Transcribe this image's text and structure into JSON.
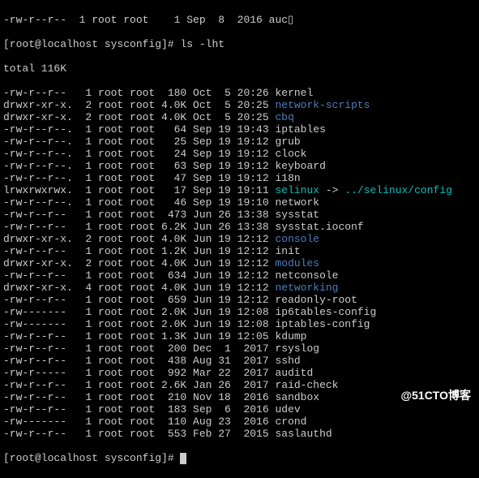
{
  "top_fragment": "-rw-r--r--  1 root root    1 Sep  8  2016 auc▯",
  "prompt": "[root@localhost sysconfig]# ",
  "command": "ls -lht",
  "total_line": "total 116K",
  "files": [
    {
      "perm": "-rw-r--r--",
      "links": "1",
      "owner": "root",
      "group": "root",
      "size": "180",
      "date": "Oct  5 20:26",
      "name": "kernel",
      "type": "file"
    },
    {
      "perm": "drwxr-xr-x.",
      "links": "2",
      "owner": "root",
      "group": "root",
      "size": "4.0K",
      "date": "Oct  5 20:25",
      "name": "network-scripts",
      "type": "dir"
    },
    {
      "perm": "drwxr-xr-x.",
      "links": "2",
      "owner": "root",
      "group": "root",
      "size": "4.0K",
      "date": "Oct  5 20:25",
      "name": "cbq",
      "type": "dir"
    },
    {
      "perm": "-rw-r--r--.",
      "links": "1",
      "owner": "root",
      "group": "root",
      "size": "64",
      "date": "Sep 19 19:43",
      "name": "iptables",
      "type": "file"
    },
    {
      "perm": "-rw-r--r--.",
      "links": "1",
      "owner": "root",
      "group": "root",
      "size": "25",
      "date": "Sep 19 19:12",
      "name": "grub",
      "type": "file"
    },
    {
      "perm": "-rw-r--r--.",
      "links": "1",
      "owner": "root",
      "group": "root",
      "size": "24",
      "date": "Sep 19 19:12",
      "name": "clock",
      "type": "file"
    },
    {
      "perm": "-rw-r--r--.",
      "links": "1",
      "owner": "root",
      "group": "root",
      "size": "63",
      "date": "Sep 19 19:12",
      "name": "keyboard",
      "type": "file"
    },
    {
      "perm": "-rw-r--r--.",
      "links": "1",
      "owner": "root",
      "group": "root",
      "size": "47",
      "date": "Sep 19 19:12",
      "name": "i18n",
      "type": "file"
    },
    {
      "perm": "lrwxrwxrwx.",
      "links": "1",
      "owner": "root",
      "group": "root",
      "size": "17",
      "date": "Sep 19 19:11",
      "name": "selinux",
      "type": "link",
      "target": "../selinux/config"
    },
    {
      "perm": "-rw-r--r--.",
      "links": "1",
      "owner": "root",
      "group": "root",
      "size": "46",
      "date": "Sep 19 19:10",
      "name": "network",
      "type": "file"
    },
    {
      "perm": "-rw-r--r--",
      "links": "1",
      "owner": "root",
      "group": "root",
      "size": "473",
      "date": "Jun 26 13:38",
      "name": "sysstat",
      "type": "file"
    },
    {
      "perm": "-rw-r--r--",
      "links": "1",
      "owner": "root",
      "group": "root",
      "size": "6.2K",
      "date": "Jun 26 13:38",
      "name": "sysstat.ioconf",
      "type": "file"
    },
    {
      "perm": "drwxr-xr-x.",
      "links": "2",
      "owner": "root",
      "group": "root",
      "size": "4.0K",
      "date": "Jun 19 12:12",
      "name": "console",
      "type": "dir"
    },
    {
      "perm": "-rw-r--r--",
      "links": "1",
      "owner": "root",
      "group": "root",
      "size": "1.2K",
      "date": "Jun 19 12:12",
      "name": "init",
      "type": "file"
    },
    {
      "perm": "drwxr-xr-x.",
      "links": "2",
      "owner": "root",
      "group": "root",
      "size": "4.0K",
      "date": "Jun 19 12:12",
      "name": "modules",
      "type": "dir"
    },
    {
      "perm": "-rw-r--r--",
      "links": "1",
      "owner": "root",
      "group": "root",
      "size": "634",
      "date": "Jun 19 12:12",
      "name": "netconsole",
      "type": "file"
    },
    {
      "perm": "drwxr-xr-x.",
      "links": "4",
      "owner": "root",
      "group": "root",
      "size": "4.0K",
      "date": "Jun 19 12:12",
      "name": "networking",
      "type": "dir"
    },
    {
      "perm": "-rw-r--r--",
      "links": "1",
      "owner": "root",
      "group": "root",
      "size": "659",
      "date": "Jun 19 12:12",
      "name": "readonly-root",
      "type": "file"
    },
    {
      "perm": "-rw-------",
      "links": "1",
      "owner": "root",
      "group": "root",
      "size": "2.0K",
      "date": "Jun 19 12:08",
      "name": "ip6tables-config",
      "type": "file"
    },
    {
      "perm": "-rw-------",
      "links": "1",
      "owner": "root",
      "group": "root",
      "size": "2.0K",
      "date": "Jun 19 12:08",
      "name": "iptables-config",
      "type": "file"
    },
    {
      "perm": "-rw-r--r--",
      "links": "1",
      "owner": "root",
      "group": "root",
      "size": "1.3K",
      "date": "Jun 19 12:05",
      "name": "kdump",
      "type": "file"
    },
    {
      "perm": "-rw-r--r--",
      "links": "1",
      "owner": "root",
      "group": "root",
      "size": "200",
      "date": "Dec  1  2017",
      "name": "rsyslog",
      "type": "file"
    },
    {
      "perm": "-rw-r--r--",
      "links": "1",
      "owner": "root",
      "group": "root",
      "size": "438",
      "date": "Aug 31  2017",
      "name": "sshd",
      "type": "file"
    },
    {
      "perm": "-rw-r-----",
      "links": "1",
      "owner": "root",
      "group": "root",
      "size": "992",
      "date": "Mar 22  2017",
      "name": "auditd",
      "type": "file"
    },
    {
      "perm": "-rw-r--r--",
      "links": "1",
      "owner": "root",
      "group": "root",
      "size": "2.6K",
      "date": "Jan 26  2017",
      "name": "raid-check",
      "type": "file"
    },
    {
      "perm": "-rw-r--r--",
      "links": "1",
      "owner": "root",
      "group": "root",
      "size": "210",
      "date": "Nov 18  2016",
      "name": "sandbox",
      "type": "file"
    },
    {
      "perm": "-rw-r--r--",
      "links": "1",
      "owner": "root",
      "group": "root",
      "size": "183",
      "date": "Sep  6  2016",
      "name": "udev",
      "type": "file"
    },
    {
      "perm": "-rw-------",
      "links": "1",
      "owner": "root",
      "group": "root",
      "size": "110",
      "date": "Aug 23  2016",
      "name": "crond",
      "type": "file"
    },
    {
      "perm": "-rw-r--r--",
      "links": "1",
      "owner": "root",
      "group": "root",
      "size": "553",
      "date": "Feb 27  2015",
      "name": "saslauthd",
      "type": "file"
    }
  ],
  "prompt2": "[root@localhost sysconfig]# ",
  "watermark": "@51CTO博客"
}
